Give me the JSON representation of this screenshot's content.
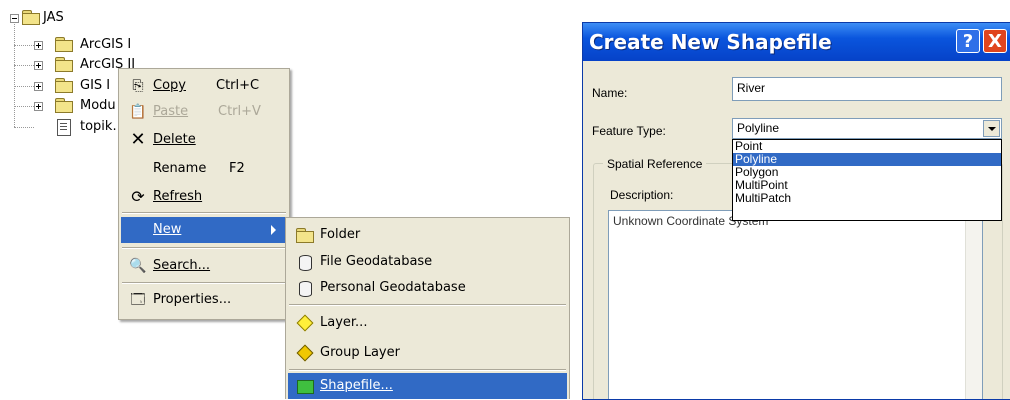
{
  "tree": {
    "root": "JAS",
    "children": [
      "ArcGIS I",
      "ArcGIS II",
      "GIS I",
      "Modu",
      "topik."
    ]
  },
  "context_menu": {
    "items": [
      {
        "label": "Copy",
        "accel": "C",
        "shortcut": "Ctrl+C",
        "icon": "copy-icon",
        "enabled": true
      },
      {
        "label": "Paste",
        "accel": "P",
        "shortcut": "Ctrl+V",
        "icon": "paste-icon",
        "enabled": false
      },
      {
        "label": "Delete",
        "accel": "D",
        "shortcut": "",
        "icon": "delete-icon",
        "enabled": true
      },
      {
        "label": "Rename",
        "accel": "m",
        "shortcut": "F2",
        "icon": "",
        "enabled": true
      },
      {
        "label": "Refresh",
        "accel": "R",
        "shortcut": "",
        "icon": "refresh-icon",
        "enabled": true
      },
      {
        "label": "New",
        "accel": "N",
        "shortcut": "",
        "icon": "",
        "enabled": true,
        "selected": true
      },
      {
        "label": "Search...",
        "accel": "S",
        "shortcut": "",
        "icon": "search-icon",
        "enabled": true
      },
      {
        "label": "Properties...",
        "accel": "i",
        "shortcut": "",
        "icon": "properties-icon",
        "enabled": true
      }
    ]
  },
  "new_submenu": {
    "items": [
      {
        "label": "Folder",
        "icon": "folder-icon"
      },
      {
        "label": "File Geodatabase",
        "icon": "file-geodatabase-icon"
      },
      {
        "label": "Personal Geodatabase",
        "icon": "personal-geodatabase-icon"
      },
      {
        "label": "Layer...",
        "icon": "layer-icon"
      },
      {
        "label": "Group Layer",
        "icon": "group-layer-icon"
      },
      {
        "label": "Shapefile...",
        "icon": "shapefile-icon",
        "selected": true
      }
    ]
  },
  "dialog": {
    "title": "Create New Shapefile",
    "help_button": "?",
    "close_button": "X",
    "name_label": "Name:",
    "name_value": "River",
    "feature_type_label": "Feature Type:",
    "feature_type_value": "Polyline",
    "feature_type_options": [
      "Point",
      "Polyline",
      "Polygon",
      "MultiPoint",
      "MultiPatch"
    ],
    "spatial_reference_label": "Spatial Reference",
    "description_label": "Description:",
    "description_value": "Unknown Coordinate System"
  },
  "colors": {
    "menu_bg": "#ece9d8",
    "selection": "#316ac5",
    "titlebar": "#0a55dd",
    "close_button": "#e0451e"
  }
}
